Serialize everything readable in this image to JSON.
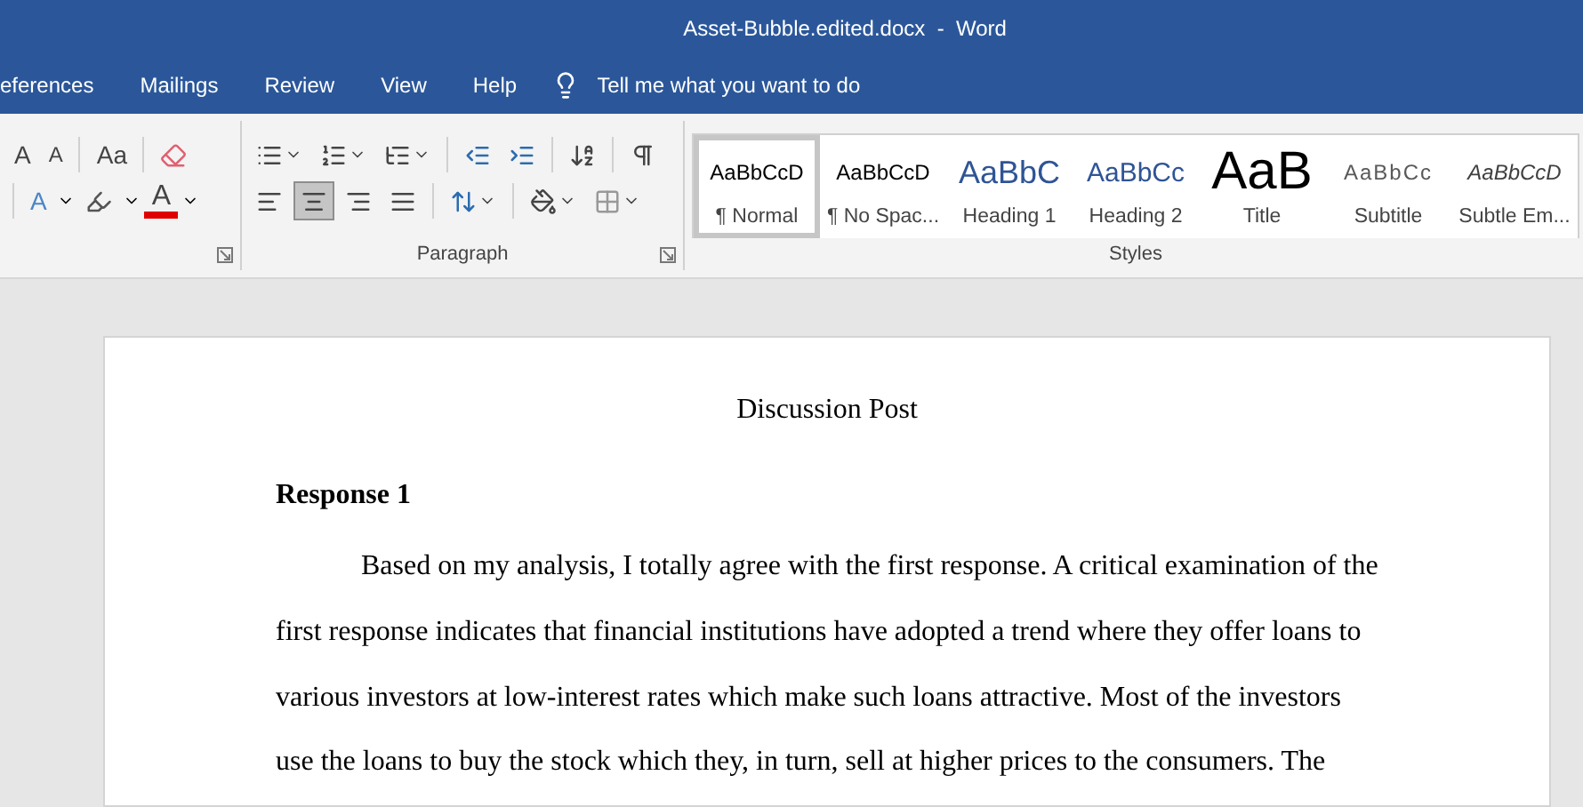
{
  "window": {
    "title": "Asset-Bubble.edited.docx  -  Word"
  },
  "tabs": [
    {
      "label": "eferences"
    },
    {
      "label": "Mailings"
    },
    {
      "label": "Review"
    },
    {
      "label": "View"
    },
    {
      "label": "Help"
    }
  ],
  "tell_me": {
    "placeholder": "Tell me what you want to do"
  },
  "font_group": {
    "grow_font": "A",
    "shrink_font": "A",
    "change_case": "Aa",
    "text_effects": "A",
    "font_color": "A"
  },
  "paragraph_group": {
    "label": "Paragraph",
    "alignment": [
      {
        "kind": "left",
        "selected": false
      },
      {
        "kind": "center",
        "selected": true
      },
      {
        "kind": "right",
        "selected": false
      },
      {
        "kind": "justify",
        "selected": false
      }
    ]
  },
  "styles": {
    "label": "Styles",
    "items": [
      {
        "kind": "normal",
        "preview": "AaBbCcD",
        "name": "¶ Normal",
        "selected": true
      },
      {
        "kind": "normal",
        "preview": "AaBbCcD",
        "name": "¶ No Spac...",
        "selected": false
      },
      {
        "kind": "heading1",
        "preview": "AaBbC",
        "name": "Heading 1",
        "selected": false
      },
      {
        "kind": "heading2",
        "preview": "AaBbCc",
        "name": "Heading 2",
        "selected": false
      },
      {
        "kind": "title",
        "preview": "AaB",
        "name": "Title",
        "selected": false
      },
      {
        "kind": "subtitle",
        "preview": "AaBbCc",
        "name": "Subtitle",
        "selected": false
      },
      {
        "kind": "emphasis",
        "preview": "AaBbCcD",
        "name": "Subtle Em...",
        "selected": false
      }
    ]
  },
  "document": {
    "title": "Discussion Post",
    "heading": "Response 1",
    "paragraph": "Based on my analysis, I totally agree with the first response. A critical examination of the first response indicates that financial institutions have adopted a trend where they offer loans to various investors at low-interest rates which make such loans attractive. Most of the investors use the loans to buy the stock which they, in turn, sell at higher prices to the consumers. The"
  }
}
